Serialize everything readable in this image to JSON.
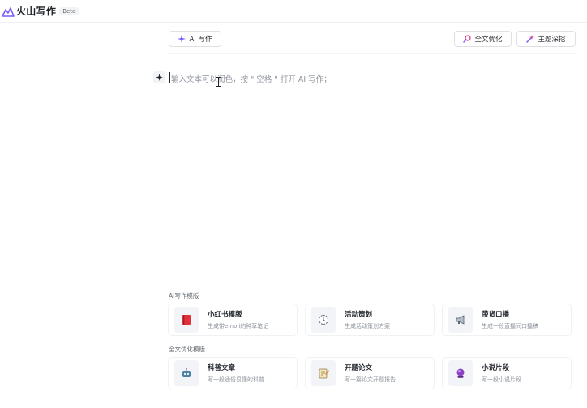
{
  "app": {
    "name": "火山写作",
    "badge": "Beta"
  },
  "toolbar": {
    "ai_write_label": "AI 写作",
    "polish_label": "全文优化",
    "theme_label": "主题深挖"
  },
  "editor": {
    "placeholder": "输入文本可以润色，按 \" 空格 \" 打开 AI 写作；"
  },
  "sections": [
    {
      "label": "AI写作模版",
      "cards": [
        {
          "title": "小红书模版",
          "desc": "生成带emoji的种草笔记",
          "icon": "red-book-icon"
        },
        {
          "title": "活动策划",
          "desc": "生成活动策划方案",
          "icon": "clock-icon"
        },
        {
          "title": "带货口播",
          "desc": "生成一段直播间口播稿",
          "icon": "megaphone-icon"
        }
      ]
    },
    {
      "label": "全文优化模版",
      "cards": [
        {
          "title": "科普文章",
          "desc": "写一段通俗易懂的科普",
          "icon": "robot-icon"
        },
        {
          "title": "开题论文",
          "desc": "写一篇论文开题报告",
          "icon": "notepad-icon"
        },
        {
          "title": "小说片段",
          "desc": "写一段小说片段",
          "icon": "crystal-ball-icon"
        }
      ]
    }
  ],
  "colors": {
    "brand": "#7b5cff",
    "accent_pink": "#e0418a"
  }
}
